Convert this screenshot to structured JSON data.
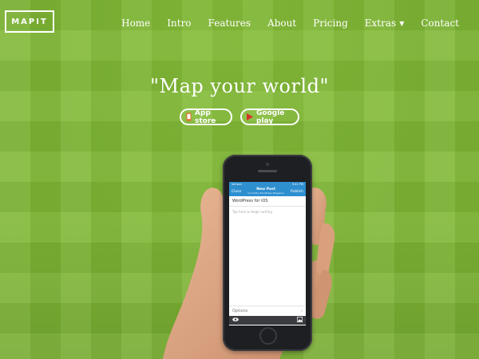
{
  "brand": {
    "logo_text": "MAPIT"
  },
  "nav": {
    "items": [
      {
        "label": "Home"
      },
      {
        "label": "Intro"
      },
      {
        "label": "Features"
      },
      {
        "label": "About"
      },
      {
        "label": "Pricing"
      },
      {
        "label": "Extras",
        "has_dropdown": true
      },
      {
        "label": "Contact"
      }
    ]
  },
  "hero": {
    "headline": "\"Map your world\"",
    "buttons": [
      {
        "label": "App store",
        "icon": "phone-icon",
        "icon_color": "#e8642c"
      },
      {
        "label": "Google play",
        "icon": "play-icon",
        "icon_color": "#d9302b"
      }
    ]
  },
  "phone_screen": {
    "status_carrier": "Verizon",
    "status_time": "9:41 PM",
    "header_left": "Close",
    "header_title": "New Post",
    "header_subtitle": "Currently WordPress Magazine",
    "header_right": "Publish",
    "post_title": "WordPress for iOS",
    "post_placeholder": "Tap here to begin writing",
    "options_label": "Options",
    "preview_icon": "eye-icon",
    "media_icon": "image-icon"
  },
  "colors": {
    "background": "#7fb735",
    "accent_blue": "#2e8fd0",
    "text": "#ffffff"
  }
}
